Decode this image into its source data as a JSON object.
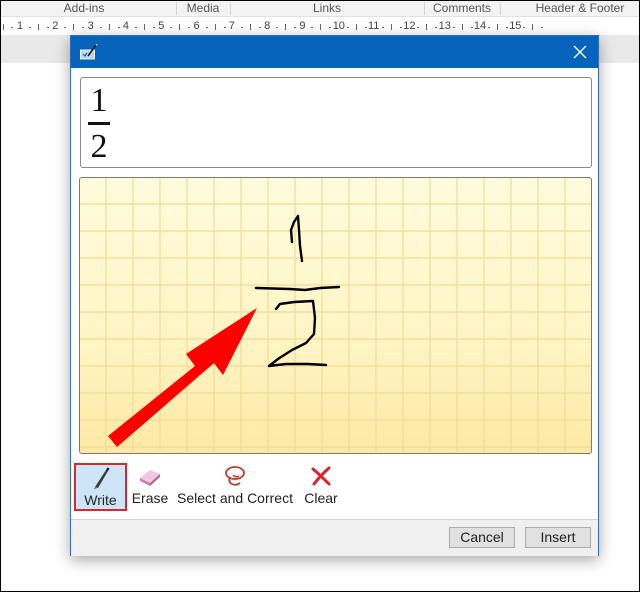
{
  "ribbon": {
    "groups": [
      {
        "label": "Add-ins"
      },
      {
        "label": "Media"
      },
      {
        "label": "Links"
      },
      {
        "label": "Comments"
      },
      {
        "label": "Header & Footer"
      }
    ]
  },
  "ruler": {
    "numbers": [
      "1",
      "2",
      "3",
      "4",
      "5",
      "6",
      "7",
      "8",
      "9",
      "10",
      "11",
      "12",
      "13",
      "14",
      "15"
    ]
  },
  "dialog": {
    "title_icon": "math-input-icon",
    "close_icon": "close-icon",
    "preview": {
      "numerator": "1",
      "denominator": "2"
    },
    "writing_pad": {
      "ink_description": "handwritten fraction 1/2",
      "annotation": "red arrow pointing to handwritten fraction"
    },
    "tools": [
      {
        "label": "Write",
        "icon": "pen-icon",
        "active": true
      },
      {
        "label": "Erase",
        "icon": "eraser-icon",
        "active": false
      },
      {
        "label": "Select and Correct",
        "icon": "lasso-icon",
        "active": false
      },
      {
        "label": "Clear",
        "icon": "clear-x-icon",
        "active": false
      }
    ],
    "buttons": {
      "cancel": "Cancel",
      "insert": "Insert"
    },
    "colors": {
      "titlebar": "#0563bb",
      "highlight_border": "#e0242a",
      "active_tool_bg": "#cde6f7",
      "arrow": "#ff0000"
    }
  }
}
